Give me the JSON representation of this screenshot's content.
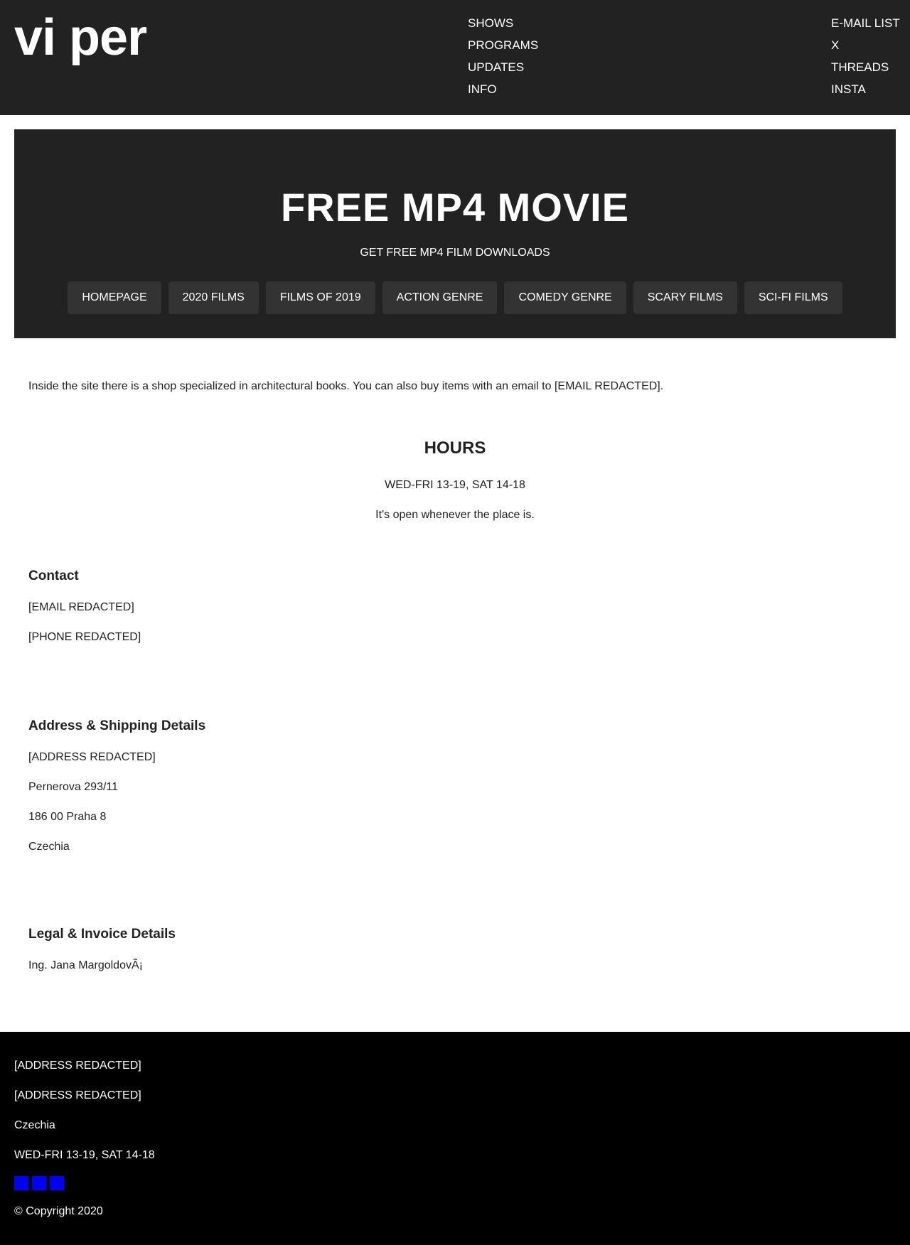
{
  "header": {
    "logo": "vi per",
    "main_nav": [
      "SHOWS",
      "PROGRAMS",
      "UPDATES",
      "INFO"
    ],
    "social_nav": [
      "E-MAIL LIST",
      "X",
      "THREADS",
      "INSTA"
    ]
  },
  "hero": {
    "title": "FREE MP4 MOVIE",
    "subtitle": "GET FREE MP4 FILM DOWNLOADS",
    "buttons": [
      "HOMEPAGE",
      "2020 FILMS",
      "FILMS OF 2019",
      "ACTION GENRE",
      "COMEDY GENRE",
      "SCARY FILMS",
      "SCI-FI FILMS"
    ]
  },
  "intro": "Inside the site there is a shop specialized in architectural books. You can also buy items with an email to [EMAIL REDACTED].",
  "hours": {
    "heading": "HOURS",
    "schedule": "WED-FRI 13-19, SAT 14-18",
    "note": "It's open whenever the place is."
  },
  "contact": {
    "heading": "Contact",
    "email": "[EMAIL REDACTED]",
    "phone": "[PHONE REDACTED]"
  },
  "address": {
    "heading": "Address & Shipping Details",
    "lines": [
      "[ADDRESS REDACTED]",
      "Pernerova 293/11",
      "186 00 Praha 8",
      "Czechia"
    ]
  },
  "legal": {
    "heading": "Legal & Invoice Details",
    "name": "Ing. Jana MargoldovÃ¡"
  },
  "footer": {
    "line1": "[ADDRESS REDACTED]",
    "line2": "[ADDRESS REDACTED]",
    "line3": "Czechia",
    "line4": "WED-FRI 13-19, SAT 14-18",
    "social_icon_color": "#0000ff",
    "copyright": "© Copyright 2020"
  },
  "colors": {
    "header_bg": "#222222",
    "button_bg": "#333333",
    "footer_bg": "#000000",
    "text": "#222222"
  }
}
